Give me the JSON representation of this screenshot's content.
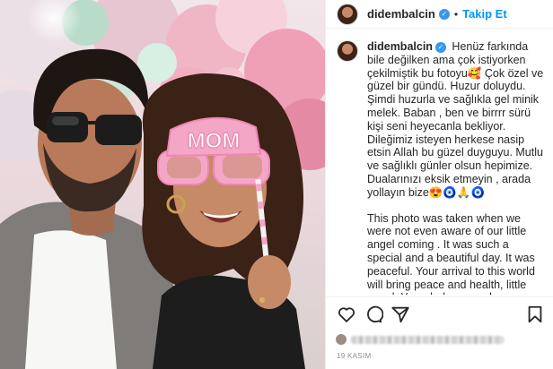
{
  "post": {
    "username": "didembalcin",
    "verified": true,
    "follow_label": "Takip Et",
    "separator": "•",
    "photo_prop_text": "MOM",
    "caption_paragraph_tr": "Henüz farkında bile değilken ama çok istiyorken çekilmiştik bu fotoyu🥰 Çok özel ve güzel bir gündü. Huzur doluydu. Şimdi huzurla ve sağlıkla gel minik melek. Baban , ben ve birrrr sürü kişi seni heyecanla bekliyor. Dileğimiz isteyen herkese nasip etsin Allah bu güzel duyguyu. Mutlu ve sağlıklı günler olsun hepimize. Dualarınızı eksik etmeyin , arada yollayın bize😍🧿🙏🧿",
    "caption_paragraph_en": "This photo was taken when we were not even aware of our little angel coming . It was such a special and a beautiful day. It was peaceful. Your arrival to this world will bring peace and health, little angel. Your dad, me, and many other people are looking forward to meeting you. May Allah",
    "date": "19 KASIM"
  },
  "icons": {
    "verified": "verified-badge-icon",
    "like": "heart-icon",
    "comment": "comment-icon",
    "share": "paper-plane-icon",
    "save": "bookmark-icon"
  },
  "colors": {
    "accent": "#0095f6",
    "verified": "#3897f0",
    "text": "#262626",
    "muted": "#8e8e8e",
    "prop_pink": "#f4a6c6"
  }
}
